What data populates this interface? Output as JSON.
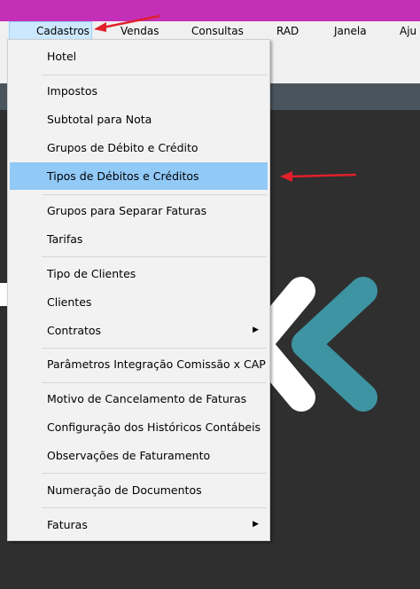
{
  "menubar": {
    "items": [
      "Cadastros",
      "Vendas",
      "Consultas",
      "RAD",
      "Janela",
      "Aju"
    ],
    "active_index": 0
  },
  "dropdown": {
    "items": [
      {
        "label": "Hotel"
      },
      {
        "label": "Impostos"
      },
      {
        "label": "Subtotal para Nota"
      },
      {
        "label": "Grupos de Débito e Crédito"
      },
      {
        "label": "Tipos de Débitos e Créditos",
        "highlighted": true
      },
      {
        "label": "Grupos para Separar Faturas"
      },
      {
        "label": "Tarifas"
      },
      {
        "label": "Tipo de Clientes"
      },
      {
        "label": "Clientes"
      },
      {
        "label": "Contratos",
        "submenu": true
      },
      {
        "label": "Parâmetros Integração Comissão x CAP"
      },
      {
        "label": "Motivo de Cancelamento de Faturas"
      },
      {
        "label": "Configuração dos Históricos Contábeis"
      },
      {
        "label": "Observações de Faturamento"
      },
      {
        "label": "Numeração de Documentos"
      },
      {
        "label": "Faturas",
        "submenu": true
      }
    ]
  },
  "colors": {
    "titlebar": "#c42fb7",
    "highlight": "#91c9f7",
    "annotation_arrow": "#e0202a",
    "logo_white": "#ffffff",
    "logo_teal": "#3e94a3"
  },
  "icons": {
    "submenu": "chevron-right-icon",
    "annotation": "red-arrow-icon"
  }
}
